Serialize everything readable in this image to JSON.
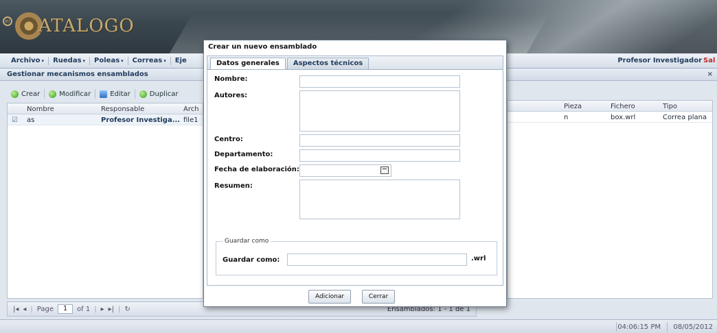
{
  "app": {
    "logo_text": "ATALOGO",
    "logo_badge": "e)"
  },
  "menu": {
    "items": [
      "Archivo",
      "Ruedas",
      "Poleas",
      "Correas",
      "Eje"
    ],
    "user": "Profesor Investigador",
    "logout": "Salir"
  },
  "panel": {
    "title": "Gestionar mecanismos ensamblados",
    "close": "×"
  },
  "toolbar": {
    "buttons": [
      "Crear",
      "Modificar",
      "Editar",
      "Duplicar"
    ]
  },
  "grid_left": {
    "headers": [
      "Nombre",
      "Responsable",
      "Arch"
    ],
    "rows": [
      {
        "select": "☑",
        "nombre": "as",
        "responsable": "Profesor Investiga...",
        "archivo": "file1"
      }
    ]
  },
  "grid_right": {
    "headers": [
      "Pieza",
      "Fichero",
      "Tipo"
    ],
    "rows": [
      {
        "pieza": "n",
        "fichero": "box.wrl",
        "tipo": "Correa plana"
      }
    ]
  },
  "pager": {
    "page_label": "Page",
    "page_value": "1",
    "of_label": "of 1",
    "count_text": "Ensamblados: 1 - 1 de 1"
  },
  "status": {
    "time": "04:06:15 PM",
    "date": "08/05/2012"
  },
  "modal": {
    "title": "Crear un nuevo ensamblado",
    "tabs": [
      "Datos generales",
      "Aspectos técnicos"
    ],
    "fields": {
      "nombre": "Nombre:",
      "autores": "Autores:",
      "centro": "Centro:",
      "departamento": "Departamento:",
      "fecha": "Fecha de elaboración:",
      "resumen": "Resumen:"
    },
    "save_group_legend": "Guardar como",
    "save_label": "Guardar como:",
    "save_ext": ".wrl",
    "buttons": {
      "add": "Adicionar",
      "close": "Cerrar"
    }
  }
}
